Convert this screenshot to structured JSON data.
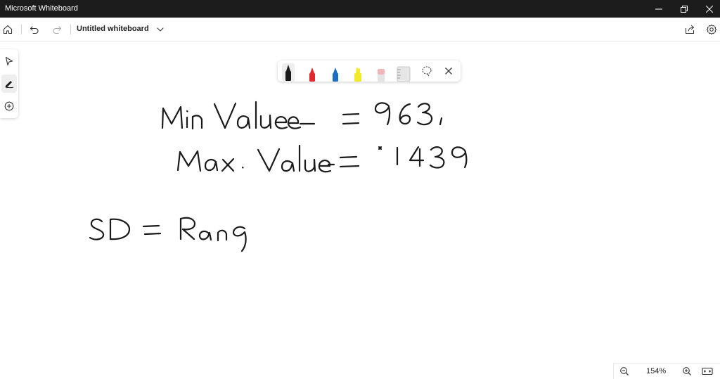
{
  "window": {
    "app_title": "Microsoft Whiteboard"
  },
  "commandbar": {
    "doc_title": "Untitled whiteboard"
  },
  "left_toolbar": {
    "tools": [
      "select-icon",
      "inking-icon",
      "add-icon"
    ],
    "active": "inking-icon"
  },
  "pen_tray": {
    "pens": [
      {
        "name": "black-pen",
        "color": "#1a1a1a"
      },
      {
        "name": "red-pen",
        "color": "#e0282e"
      },
      {
        "name": "blue-pen",
        "color": "#1d6fc4"
      },
      {
        "name": "yellow-highlighter",
        "color": "#f2ea2a"
      },
      {
        "name": "eraser",
        "color": "#f2b6b8"
      },
      {
        "name": "ruler",
        "color": "#d6d6d6"
      }
    ],
    "active": "black-pen"
  },
  "zoom": {
    "level": "154%"
  },
  "colors": {
    "titlebar": "#1c1c1c",
    "ink": "#1a1a1a"
  }
}
